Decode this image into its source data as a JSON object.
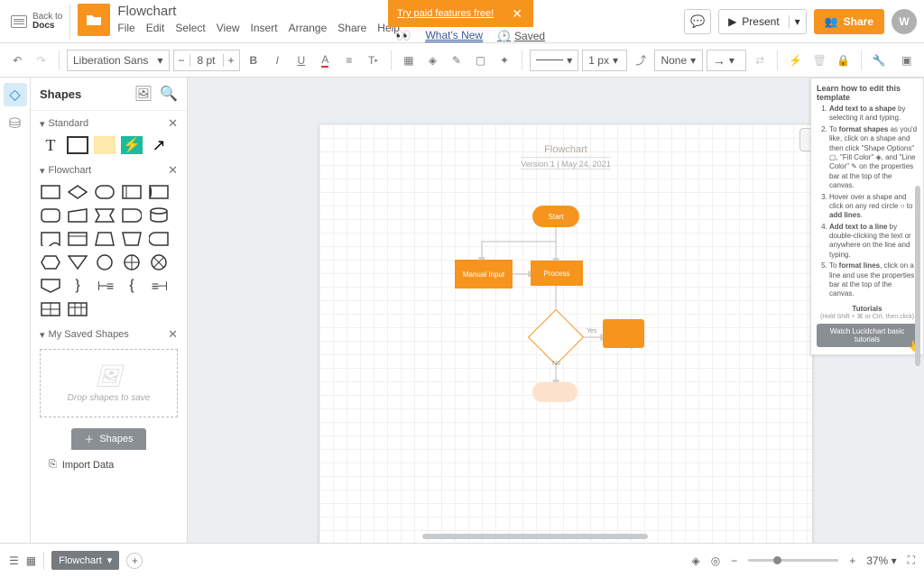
{
  "header": {
    "back_label_1": "Back to",
    "back_label_2": "Docs",
    "doc_title": "Flowchart",
    "menu": [
      "File",
      "Edit",
      "Select",
      "View",
      "Insert",
      "Arrange",
      "Share",
      "Help"
    ],
    "promo_text": "Try paid features free!",
    "whats_new": "What's New",
    "saved": "Saved",
    "present": "Present",
    "share": "Share",
    "avatar_letter": "W"
  },
  "toolbar": {
    "font": "Liberation Sans",
    "size": "8 pt",
    "line_width": "1 px",
    "arrow_start": "None"
  },
  "panel": {
    "title": "Shapes",
    "sec_standard": "Standard",
    "sec_flowchart": "Flowchart",
    "sec_mysaved": "My Saved Shapes",
    "drop_hint": "Drop shapes to save",
    "shapes_btn": "Shapes",
    "import": "Import Data"
  },
  "canvas": {
    "title": "Flowchart",
    "subtitle": "Version 1   |   May 24, 2021",
    "nodes": {
      "start": "Start",
      "manual_input": "Manual Input",
      "process": "Process",
      "yes": "Yes",
      "no": "No"
    }
  },
  "help": {
    "title": "Learn how to edit this template",
    "items": [
      "<b>Add text to a shape</b> by selecting it and typing.",
      "To <b>format shapes</b> as you'd like, click on a shape and then click \"Shape Options\" ▢, \"Fill Color\" ◈, and \"Line Color\" ✎ on the properties bar at the top of the canvas.",
      "Hover over a shape and click on any red circle ○ to <b>add lines</b>.",
      "<b>Add text to a line</b> by double-clicking the text or anywhere on the line and typing.",
      "To <b>format lines</b>, click on a line and use the properties bar at the top of the canvas."
    ],
    "tutorials": "Tutorials",
    "hint": "(Hold Shift + ⌘ or Ctrl, then click)",
    "watch": "Watch Lucidchart basic tutorials"
  },
  "footer": {
    "page_tab": "Flowchart",
    "zoom": "37%"
  }
}
